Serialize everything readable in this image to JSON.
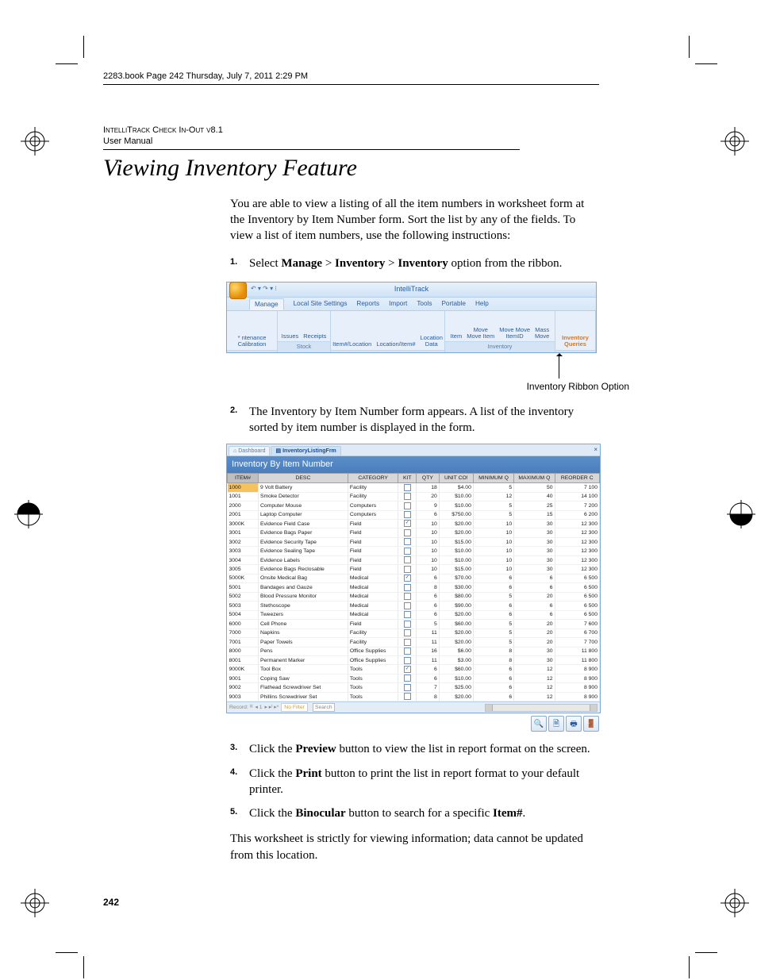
{
  "bookline": "2283.book  Page 242  Thursday, July 7, 2011  2:29 PM",
  "running_head": {
    "line1": "IntelliTrack Check In-Out v8.1",
    "line2": "User Manual"
  },
  "title": "Viewing Inventory Feature",
  "intro": "You are able to view a listing of all the item numbers in worksheet form at the Inventory by Item Number form. Sort the list by any of the fields. To view a list of item numbers, use the following instructions:",
  "steps": {
    "s1": {
      "num": "1.",
      "pre": "Select ",
      "b1": "Manage",
      "mid1": " > ",
      "b2": "Inventory",
      "mid2": " > ",
      "b3": "Inventory",
      "post": " option from the ribbon."
    },
    "s2": {
      "num": "2.",
      "text": "The Inventory by Item Number form appears. A list of the inventory sorted by item number is displayed in the form."
    },
    "s3": {
      "num": "3.",
      "pre": "Click the ",
      "b": "Preview",
      "post": " button to view the list in report format on the screen."
    },
    "s4": {
      "num": "4.",
      "pre": "Click the ",
      "b": "Print",
      "post": " button to print the list in report format to your default printer."
    },
    "s5": {
      "num": "5.",
      "pre": "Click the ",
      "b": "Binocular",
      "mid": " button to search for a specific ",
      "b2": "Item#",
      "post": "."
    }
  },
  "closing": "This worksheet is strictly for viewing information; data cannot be updated from this location.",
  "ribbon_caption": "Inventory Ribbon Option",
  "ribbon": {
    "app_title": "IntelliTrack",
    "qat": "↶ ▾ ↷ ▾ ⁝",
    "tabs": [
      "Manage",
      "Local Site Settings",
      "Reports",
      "Import",
      "Tools",
      "Portable",
      "Help"
    ],
    "groups": {
      "g1": {
        "items": [
          "* ntenance",
          "Calibration"
        ],
        "label": ""
      },
      "g2": {
        "items": [
          "Issues",
          "Receipts"
        ],
        "label": "Stock"
      },
      "g3": {
        "items": [
          "Item#/Location",
          "Location/Item#",
          "Location\nData"
        ],
        "label": ""
      },
      "g4": {
        "items": [
          "Item",
          "Move\nMove Item",
          "Move Move\nItemID",
          "Mass\nMove"
        ],
        "label": "Inventory"
      },
      "g5": {
        "items": [
          "Inventory Queries"
        ],
        "label": ""
      }
    }
  },
  "inv": {
    "tab1": "Dashboard",
    "tab2": "InventoryListingFrm",
    "close": "×",
    "title": "Inventory By Item Number",
    "headers": [
      "ITEM#",
      "DESC",
      "CATEGORY",
      "KIT",
      "QTY",
      "UNIT CO!",
      "MINIMUM Q",
      "MAXIMUM Q",
      "REORDER C"
    ],
    "rows": [
      {
        "item": "1000",
        "desc": "9 Volt Battery",
        "cat": "Facility",
        "kit": "",
        "qty": "18",
        "uc": "$4.00",
        "min": "5",
        "max": "50",
        "re": "7 100"
      },
      {
        "item": "1001",
        "desc": "Smoke Detector",
        "cat": "Facility",
        "kit": "",
        "qty": "20",
        "uc": "$10.00",
        "min": "12",
        "max": "40",
        "re": "14 100"
      },
      {
        "item": "2000",
        "desc": "Computer Mouse",
        "cat": "Computers",
        "kit": "",
        "qty": "9",
        "uc": "$10.00",
        "min": "5",
        "max": "25",
        "re": "7 200"
      },
      {
        "item": "2001",
        "desc": "Laptop Computer",
        "cat": "Computers",
        "kit": "",
        "qty": "6",
        "uc": "$750.00",
        "min": "5",
        "max": "15",
        "re": "6 200"
      },
      {
        "item": "3000K",
        "desc": "Evidence Field Case",
        "cat": "Field",
        "kit": "✓",
        "qty": "10",
        "uc": "$20.00",
        "min": "10",
        "max": "30",
        "re": "12 300"
      },
      {
        "item": "3001",
        "desc": "Evidence Bags Paper",
        "cat": "Field",
        "kit": "",
        "qty": "10",
        "uc": "$20.00",
        "min": "10",
        "max": "30",
        "re": "12 300"
      },
      {
        "item": "3002",
        "desc": "Evidence Security Tape",
        "cat": "Field",
        "kit": "",
        "qty": "10",
        "uc": "$15.00",
        "min": "10",
        "max": "30",
        "re": "12 300"
      },
      {
        "item": "3003",
        "desc": "Evidence Sealing Tape",
        "cat": "Field",
        "kit": "",
        "qty": "10",
        "uc": "$10.00",
        "min": "10",
        "max": "30",
        "re": "12 300"
      },
      {
        "item": "3004",
        "desc": "Evidence Labels",
        "cat": "Field",
        "kit": "",
        "qty": "10",
        "uc": "$10.00",
        "min": "10",
        "max": "30",
        "re": "12 300"
      },
      {
        "item": "3005",
        "desc": "Evidence Bags Reclosable",
        "cat": "Field",
        "kit": "",
        "qty": "10",
        "uc": "$15.00",
        "min": "10",
        "max": "30",
        "re": "12 300"
      },
      {
        "item": "5000K",
        "desc": "Onsite Medical Bag",
        "cat": "Medical",
        "kit": "✓",
        "qty": "6",
        "uc": "$70.00",
        "min": "6",
        "max": "6",
        "re": "6 500"
      },
      {
        "item": "5001",
        "desc": "Bandages and Gauze",
        "cat": "Medical",
        "kit": "",
        "qty": "8",
        "uc": "$30.00",
        "min": "6",
        "max": "6",
        "re": "6 500"
      },
      {
        "item": "5002",
        "desc": "Blood Pressure Monitor",
        "cat": "Medical",
        "kit": "",
        "qty": "6",
        "uc": "$80.00",
        "min": "5",
        "max": "20",
        "re": "6 500"
      },
      {
        "item": "5003",
        "desc": "Stethoscope",
        "cat": "Medical",
        "kit": "",
        "qty": "6",
        "uc": "$90.00",
        "min": "6",
        "max": "6",
        "re": "6 500"
      },
      {
        "item": "5004",
        "desc": "Tweezers",
        "cat": "Medical",
        "kit": "",
        "qty": "6",
        "uc": "$20.00",
        "min": "6",
        "max": "6",
        "re": "6 500"
      },
      {
        "item": "6000",
        "desc": "Cell Phone",
        "cat": "Field",
        "kit": "",
        "qty": "5",
        "uc": "$60.00",
        "min": "5",
        "max": "20",
        "re": "7 600"
      },
      {
        "item": "7000",
        "desc": "Napkins",
        "cat": "Facility",
        "kit": "",
        "qty": "11",
        "uc": "$20.00",
        "min": "5",
        "max": "20",
        "re": "6 700"
      },
      {
        "item": "7001",
        "desc": "Paper Towels",
        "cat": "Facility",
        "kit": "",
        "qty": "11",
        "uc": "$20.00",
        "min": "5",
        "max": "20",
        "re": "7 700"
      },
      {
        "item": "8000",
        "desc": "Pens",
        "cat": "Office Supplies",
        "kit": "",
        "qty": "16",
        "uc": "$6.00",
        "min": "8",
        "max": "30",
        "re": "11 800"
      },
      {
        "item": "8001",
        "desc": "Permanent Marker",
        "cat": "Office Supplies",
        "kit": "",
        "qty": "11",
        "uc": "$3.00",
        "min": "8",
        "max": "30",
        "re": "11 800"
      },
      {
        "item": "9000K",
        "desc": "Tool Box",
        "cat": "Tools",
        "kit": "✓",
        "qty": "6",
        "uc": "$60.00",
        "min": "6",
        "max": "12",
        "re": "8 900"
      },
      {
        "item": "9001",
        "desc": "Coping Saw",
        "cat": "Tools",
        "kit": "",
        "qty": "6",
        "uc": "$10.00",
        "min": "6",
        "max": "12",
        "re": "8 900"
      },
      {
        "item": "9002",
        "desc": "Flathead Screwdriver Set",
        "cat": "Tools",
        "kit": "",
        "qty": "7",
        "uc": "$25.00",
        "min": "6",
        "max": "12",
        "re": "8 900"
      },
      {
        "item": "9003",
        "desc": "Phillins Screwdriver Set",
        "cat": "Tools",
        "kit": "",
        "qty": "8",
        "uc": "$20.00",
        "min": "6",
        "max": "12",
        "re": "8 900"
      }
    ],
    "footer": {
      "record_label": "Record: ᴵᵈ",
      "rec_of": "◂ 1",
      "nav": "▸ ▸ᴵ ▸*",
      "nofilter": "No Filter",
      "search": "Search"
    }
  },
  "toolbar_icons": {
    "binocular": "🔍",
    "preview": "🗎",
    "print": "🖶",
    "exit": "🚪"
  },
  "pagenum": "242"
}
